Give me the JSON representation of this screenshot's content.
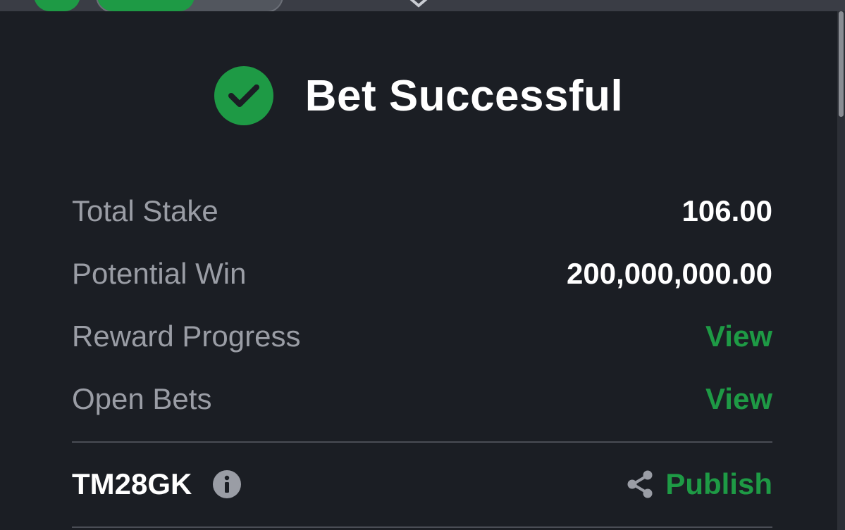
{
  "colors": {
    "accent": "#1e9a45",
    "background": "#1b1e24",
    "label": "#9a9da5",
    "value": "#ffffff"
  },
  "header": {
    "icon": "check-circle-icon",
    "title": "Bet Successful"
  },
  "summary": {
    "total_stake_label": "Total Stake",
    "total_stake_value": "106.00",
    "potential_win_label": "Potential Win",
    "potential_win_value": "200,000,000.00",
    "reward_progress_label": "Reward Progress",
    "reward_progress_link": "View",
    "open_bets_label": "Open Bets",
    "open_bets_link": "View"
  },
  "booking": {
    "code": "TM28GK",
    "info_icon": "info-icon",
    "share_icon": "share-icon",
    "publish_label": "Publish"
  }
}
